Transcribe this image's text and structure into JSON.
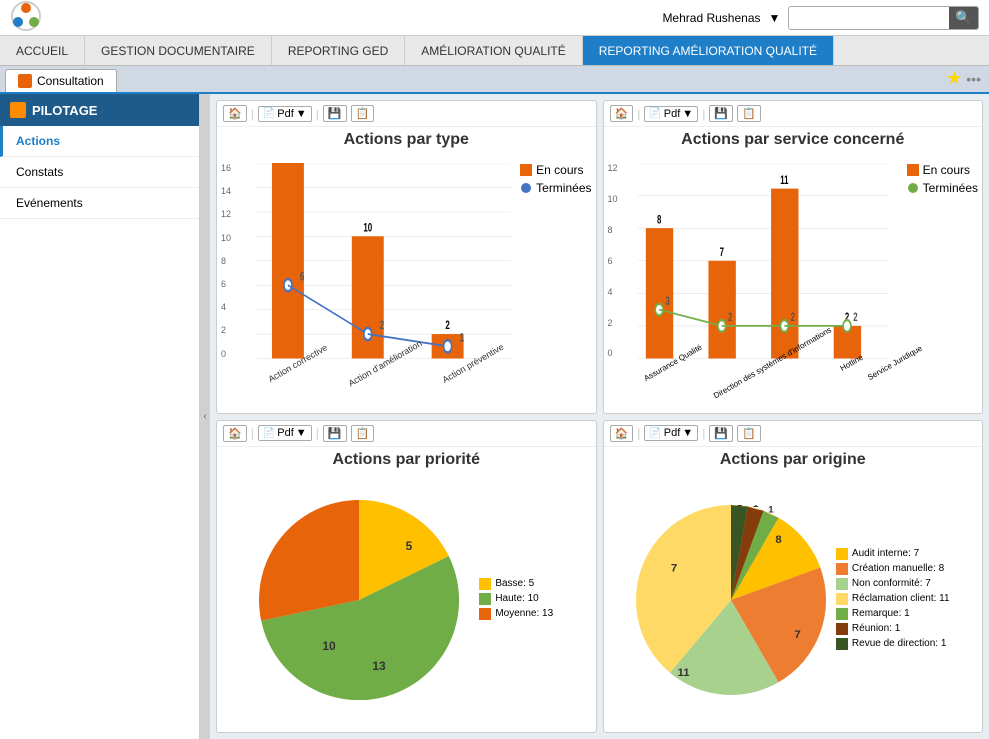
{
  "topbar": {
    "user": "Mehrad Rushenas",
    "search_placeholder": ""
  },
  "nav": {
    "items": [
      {
        "label": "ACCUEIL",
        "active": false
      },
      {
        "label": "GESTION DOCUMENTAIRE",
        "active": false
      },
      {
        "label": "REPORTING GED",
        "active": false
      },
      {
        "label": "AMÉLIORATION QUALITÉ",
        "active": false
      },
      {
        "label": "REPORTING AMÉLIORATION QUALITÉ",
        "active": true
      }
    ]
  },
  "tab": {
    "label": "Consultation"
  },
  "sidebar": {
    "header": "PILOTAGE",
    "items": [
      {
        "label": "Actions",
        "active": true
      },
      {
        "label": "Constats",
        "active": false
      },
      {
        "label": "Evénements",
        "active": false
      }
    ]
  },
  "charts": {
    "chart1": {
      "title": "Actions par type",
      "toolbar": {
        "pdf": "Pdf"
      },
      "legend": [
        {
          "label": "En cours",
          "color": "#e8640a"
        },
        {
          "label": "Terminées",
          "color": "#4472c4"
        }
      ],
      "bars": [
        {
          "label": "Action corrective",
          "en_cours": 16,
          "terminees": 6
        },
        {
          "label": "Action d'amélioration",
          "en_cours": 10,
          "terminees": 2
        },
        {
          "label": "Action préventive",
          "en_cours": 2,
          "terminees": 1
        }
      ],
      "y_max": 16
    },
    "chart2": {
      "title": "Actions par service concerné",
      "toolbar": {
        "pdf": "Pdf"
      },
      "legend": [
        {
          "label": "En cours",
          "color": "#e8640a"
        },
        {
          "label": "Terminées",
          "color": "#70ad47"
        }
      ],
      "bars": [
        {
          "label": "Assurance Qualité",
          "en_cours": 8,
          "terminees": 3
        },
        {
          "label": "Direction des systèmes d'informations",
          "en_cours": 7,
          "terminees": 2
        },
        {
          "label": "Hotline",
          "en_cours": 11,
          "terminees": 2
        },
        {
          "label": "Service Juridique",
          "en_cours": 2,
          "terminees": 2
        }
      ],
      "y_max": 12
    },
    "chart3": {
      "title": "Actions par priorité",
      "toolbar": {
        "pdf": "Pdf"
      },
      "legend": [
        {
          "label": "Basse: 5",
          "color": "#ffc000"
        },
        {
          "label": "Haute: 10",
          "color": "#70ad47"
        },
        {
          "label": "Moyenne: 13",
          "color": "#e8640a"
        }
      ],
      "segments": [
        {
          "label": "5",
          "value": 5,
          "color": "#ffc000",
          "angle": 64
        },
        {
          "label": "10",
          "value": 10,
          "color": "#70ad47",
          "angle": 129
        },
        {
          "label": "13",
          "value": 13,
          "color": "#e8640a",
          "angle": 167
        }
      ]
    },
    "chart4": {
      "title": "Actions par origine",
      "toolbar": {
        "pdf": "Pdf"
      },
      "legend": [
        {
          "label": "Audit interne: 7",
          "color": "#ffc000"
        },
        {
          "label": "Création manuelle: 8",
          "color": "#ed7d31"
        },
        {
          "label": "Non conformité: 7",
          "color": "#a9d18e"
        },
        {
          "label": "Réclamation client: 11",
          "color": "#ffd966"
        },
        {
          "label": "Remarque: 1",
          "color": "#70ad47"
        },
        {
          "label": "Réunion: 1",
          "color": "#843c0c"
        },
        {
          "label": "Revue de direction: 1",
          "color": "#375623"
        }
      ],
      "labels": [
        "8",
        "7",
        "11",
        "7",
        "1",
        "1",
        "1"
      ]
    }
  }
}
